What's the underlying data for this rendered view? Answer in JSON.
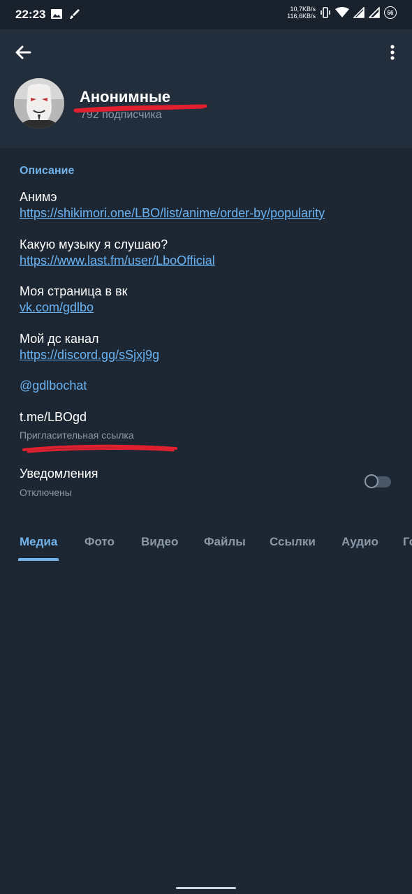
{
  "status_bar": {
    "time": "22:23",
    "upload_speed": "10,7KB/s",
    "download_speed": "116,6KB/s",
    "icons": [
      "gallery-icon",
      "paint-icon",
      "vibrate-icon",
      "wifi-icon",
      "signal-icon",
      "signal-icon",
      "battery-icon"
    ],
    "battery_level": "56"
  },
  "header": {
    "title": "Анонимные",
    "subtitle": "792 подписчика"
  },
  "description": {
    "section_title": "Описание",
    "blocks": [
      {
        "text": "Анимэ",
        "link": "https://shikimori.one/LBO/list/anime/order-by/popularity"
      },
      {
        "text": "Какую музыку я слушаю?",
        "link": "https://www.last.fm/user/LboOfficial"
      },
      {
        "text": "Моя страница в вк",
        "link": "vk.com/gdlbo"
      },
      {
        "text": "Мой дс канал",
        "link": "https://discord.gg/sSjxj9g"
      }
    ],
    "mention": "@gdlbochat"
  },
  "invite": {
    "link": "t.me/LBOgd",
    "label": "Пригласительная ссылка"
  },
  "notifications": {
    "title": "Уведомления",
    "status": "Отключены",
    "enabled": false
  },
  "tabs": [
    "Медиа",
    "Фото",
    "Видео",
    "Файлы",
    "Ссылки",
    "Аудио",
    "Го"
  ],
  "active_tab": "Медиа",
  "colors": {
    "background": "#1d2733",
    "header": "#232e3c",
    "accent": "#71b2ea",
    "link": "#6ab3f3",
    "secondary_text": "#8a98a8",
    "redaction": "#e0202f"
  }
}
